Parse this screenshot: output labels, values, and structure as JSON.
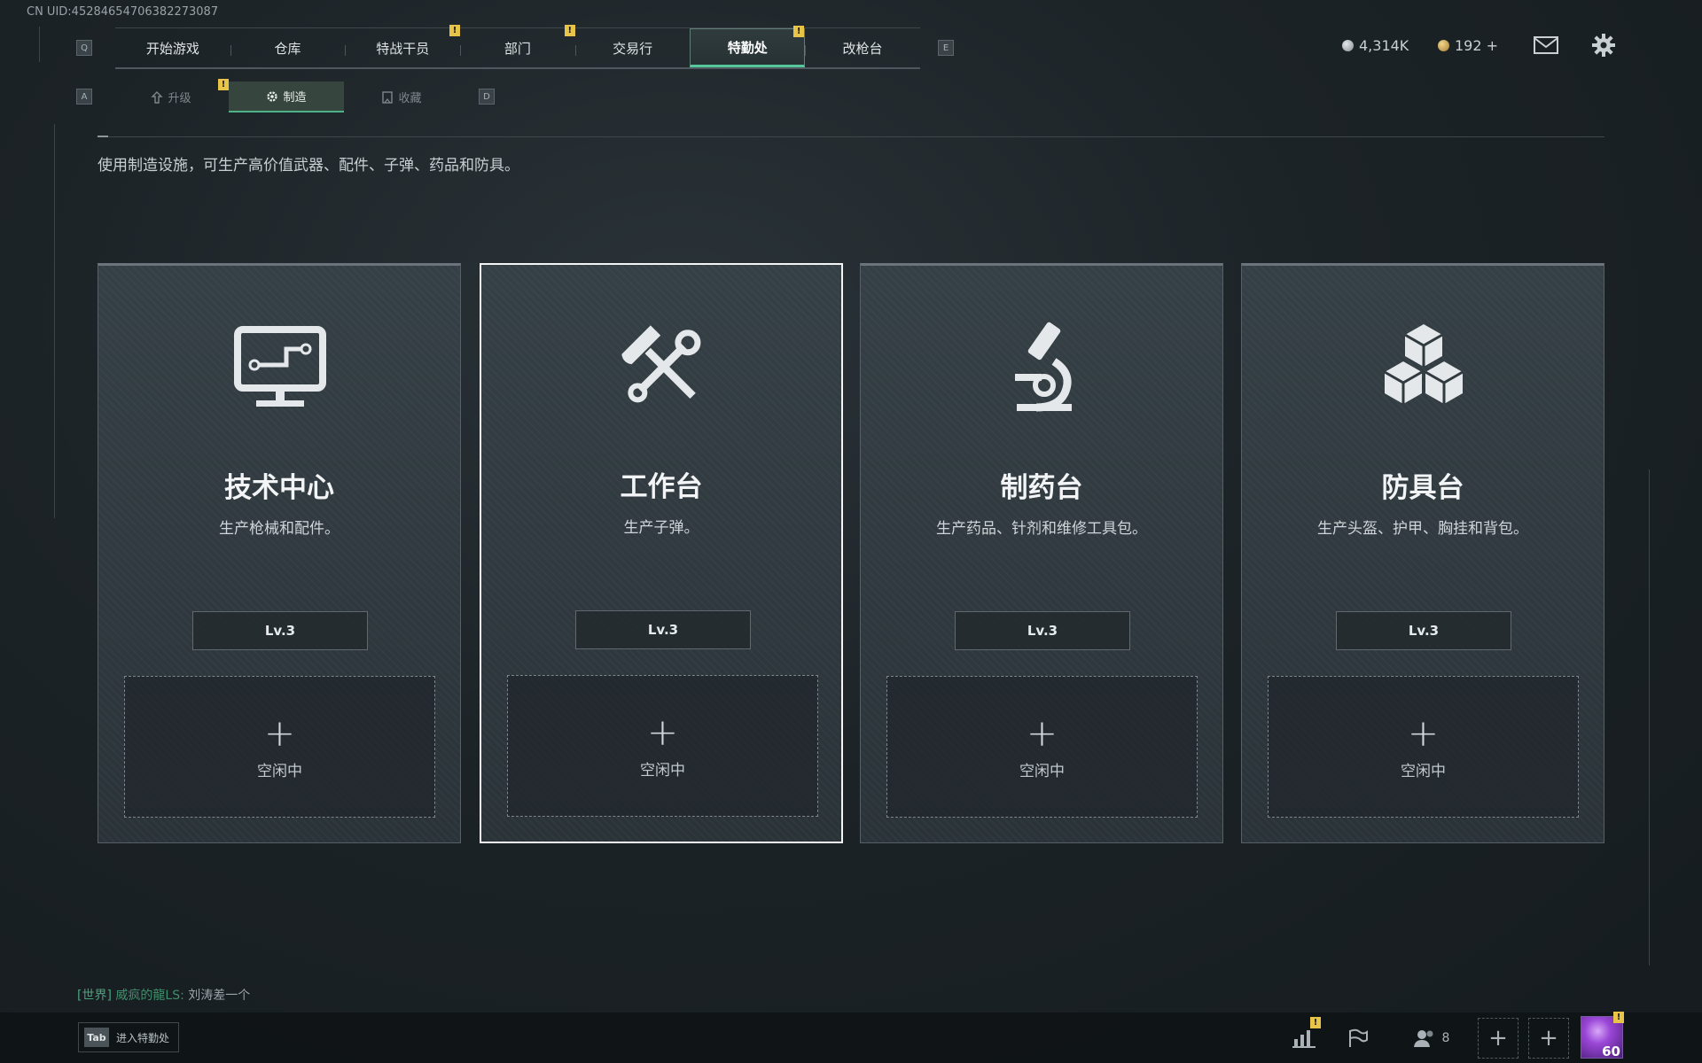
{
  "header": {
    "uid": "CN UID:45284654706382273087"
  },
  "keys": {
    "prev_tab": "Q",
    "next_tab": "E",
    "prev_sub": "A",
    "next_sub": "D"
  },
  "nav": {
    "tabs": [
      {
        "label": "开始游戏",
        "alert": false,
        "active": false
      },
      {
        "label": "仓库",
        "alert": false,
        "active": false
      },
      {
        "label": "特战干员",
        "alert": true,
        "active": false
      },
      {
        "label": "部门",
        "alert": true,
        "active": false
      },
      {
        "label": "交易行",
        "alert": false,
        "active": false
      },
      {
        "label": "特勤处",
        "alert": true,
        "active": true
      },
      {
        "label": "改枪台",
        "alert": false,
        "active": false
      }
    ],
    "alert_symbol": "!"
  },
  "resources": {
    "silver": "4,314K",
    "gold": "192 +",
    "silver_color": "#c0c6ca",
    "gold_color": "#d2aa55"
  },
  "sub_nav": {
    "tabs": [
      {
        "label": "升级",
        "icon": "upgrade-icon",
        "alert": true,
        "active": false
      },
      {
        "label": "制造",
        "icon": "craft-gear-icon",
        "alert": false,
        "active": true
      },
      {
        "label": "收藏",
        "icon": "collection-icon",
        "alert": false,
        "active": false
      }
    ]
  },
  "page": {
    "description": "使用制造设施，可生产高价值武器、配件、子弹、药品和防具。"
  },
  "facilities": [
    {
      "name": "技术中心",
      "desc": "生产枪械和配件。",
      "level": "Lv.3",
      "slot": "空闲中",
      "icon": "computer-icon",
      "selected": false
    },
    {
      "name": "工作台",
      "desc": "生产子弹。",
      "level": "Lv.3",
      "slot": "空闲中",
      "icon": "hammer-wrench-icon",
      "selected": true
    },
    {
      "name": "制药台",
      "desc": "生产药品、针剂和维修工具包。",
      "level": "Lv.3",
      "slot": "空闲中",
      "icon": "microscope-icon",
      "selected": false
    },
    {
      "name": "防具台",
      "desc": "生产头盔、护甲、胸挂和背包。",
      "level": "Lv.3",
      "slot": "空闲中",
      "icon": "cubes-icon",
      "selected": false
    }
  ],
  "slot_plus": "+",
  "chat": {
    "channel": "[世界]",
    "name": "威疯的龍LS:",
    "message": "刘涛差一个"
  },
  "bottom": {
    "tab_key": "Tab",
    "tab_label": "进入特勤处",
    "friends_count": "8",
    "player_level": "60",
    "add_symbol": "+"
  },
  "colors": {
    "accent_green": "#56c79a",
    "alert_yellow": "#e8c548",
    "card_bg": "#303a3f"
  }
}
